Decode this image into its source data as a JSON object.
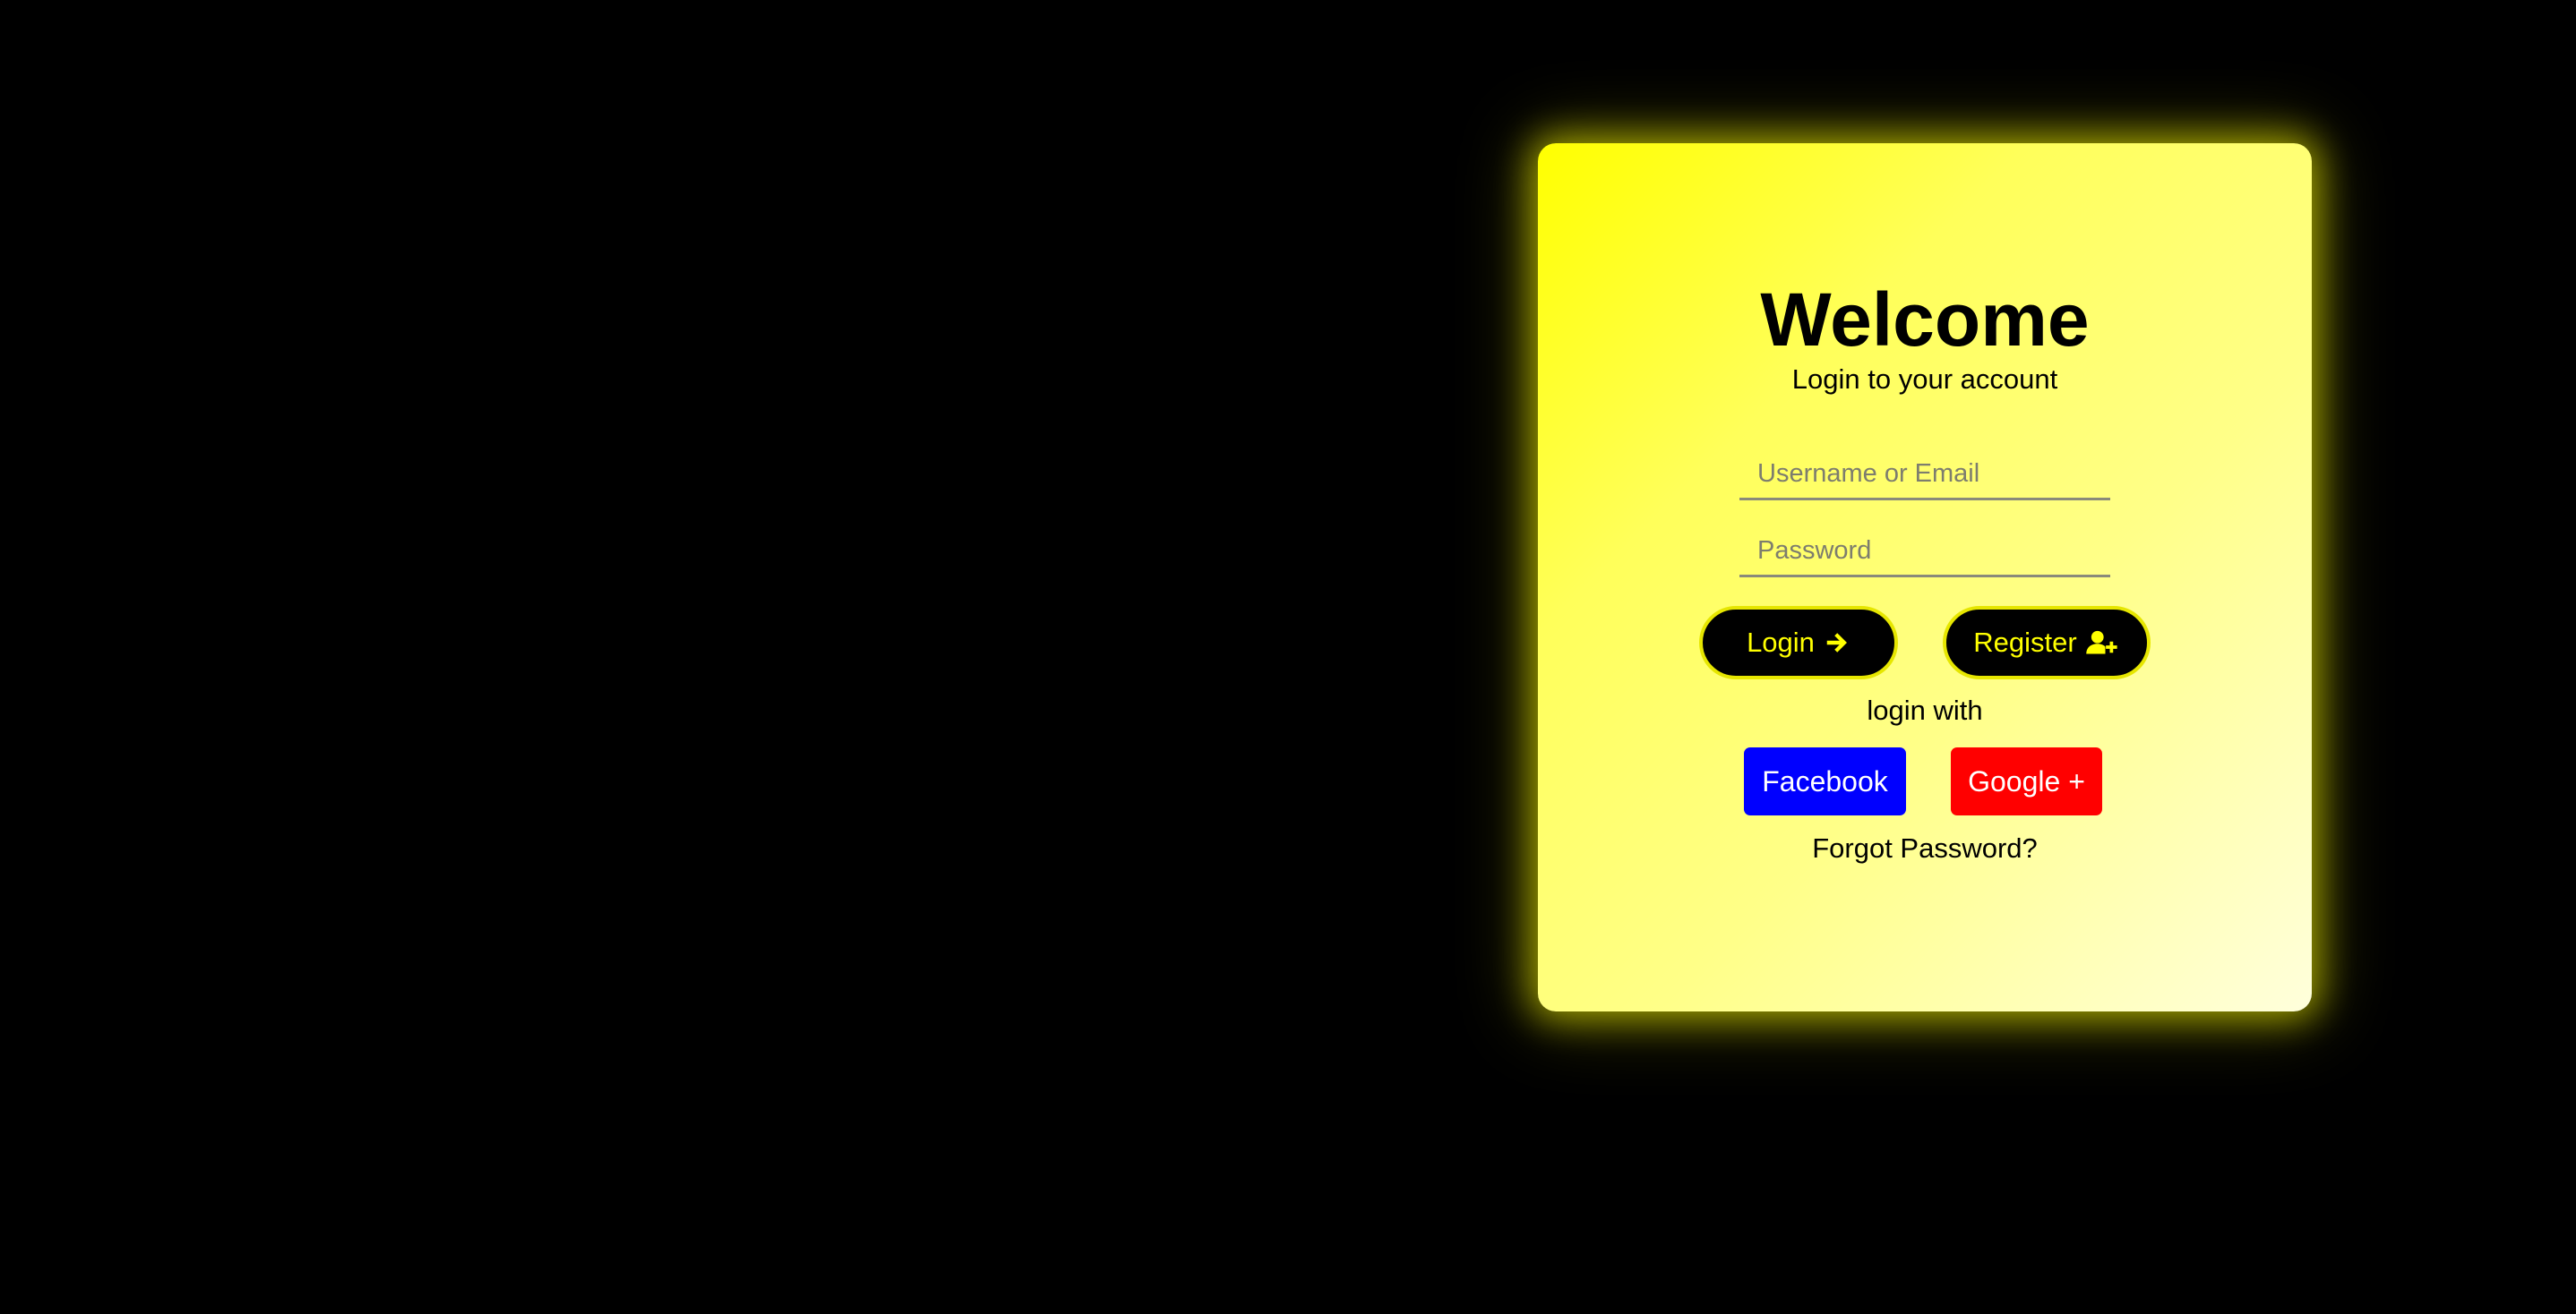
{
  "page": {
    "background_color": "#000000",
    "accent_color": "#ffff00"
  },
  "login_card": {
    "title": "Welcome",
    "subtitle": "Login to your account",
    "username_field": {
      "placeholder": "Username or Email",
      "value": ""
    },
    "password_field": {
      "placeholder": "Password",
      "value": ""
    },
    "login_button": {
      "label": "Login",
      "icon": "arrow-right-icon"
    },
    "register_button": {
      "label": "Register",
      "icon": "user-plus-icon"
    },
    "social_prompt": "login with",
    "social_buttons": {
      "facebook": {
        "label": "Facebook",
        "color": "#0000ff"
      },
      "google": {
        "label": "Google +",
        "color": "#ff0000"
      }
    },
    "forgot_password_link": "Forgot Password?"
  }
}
